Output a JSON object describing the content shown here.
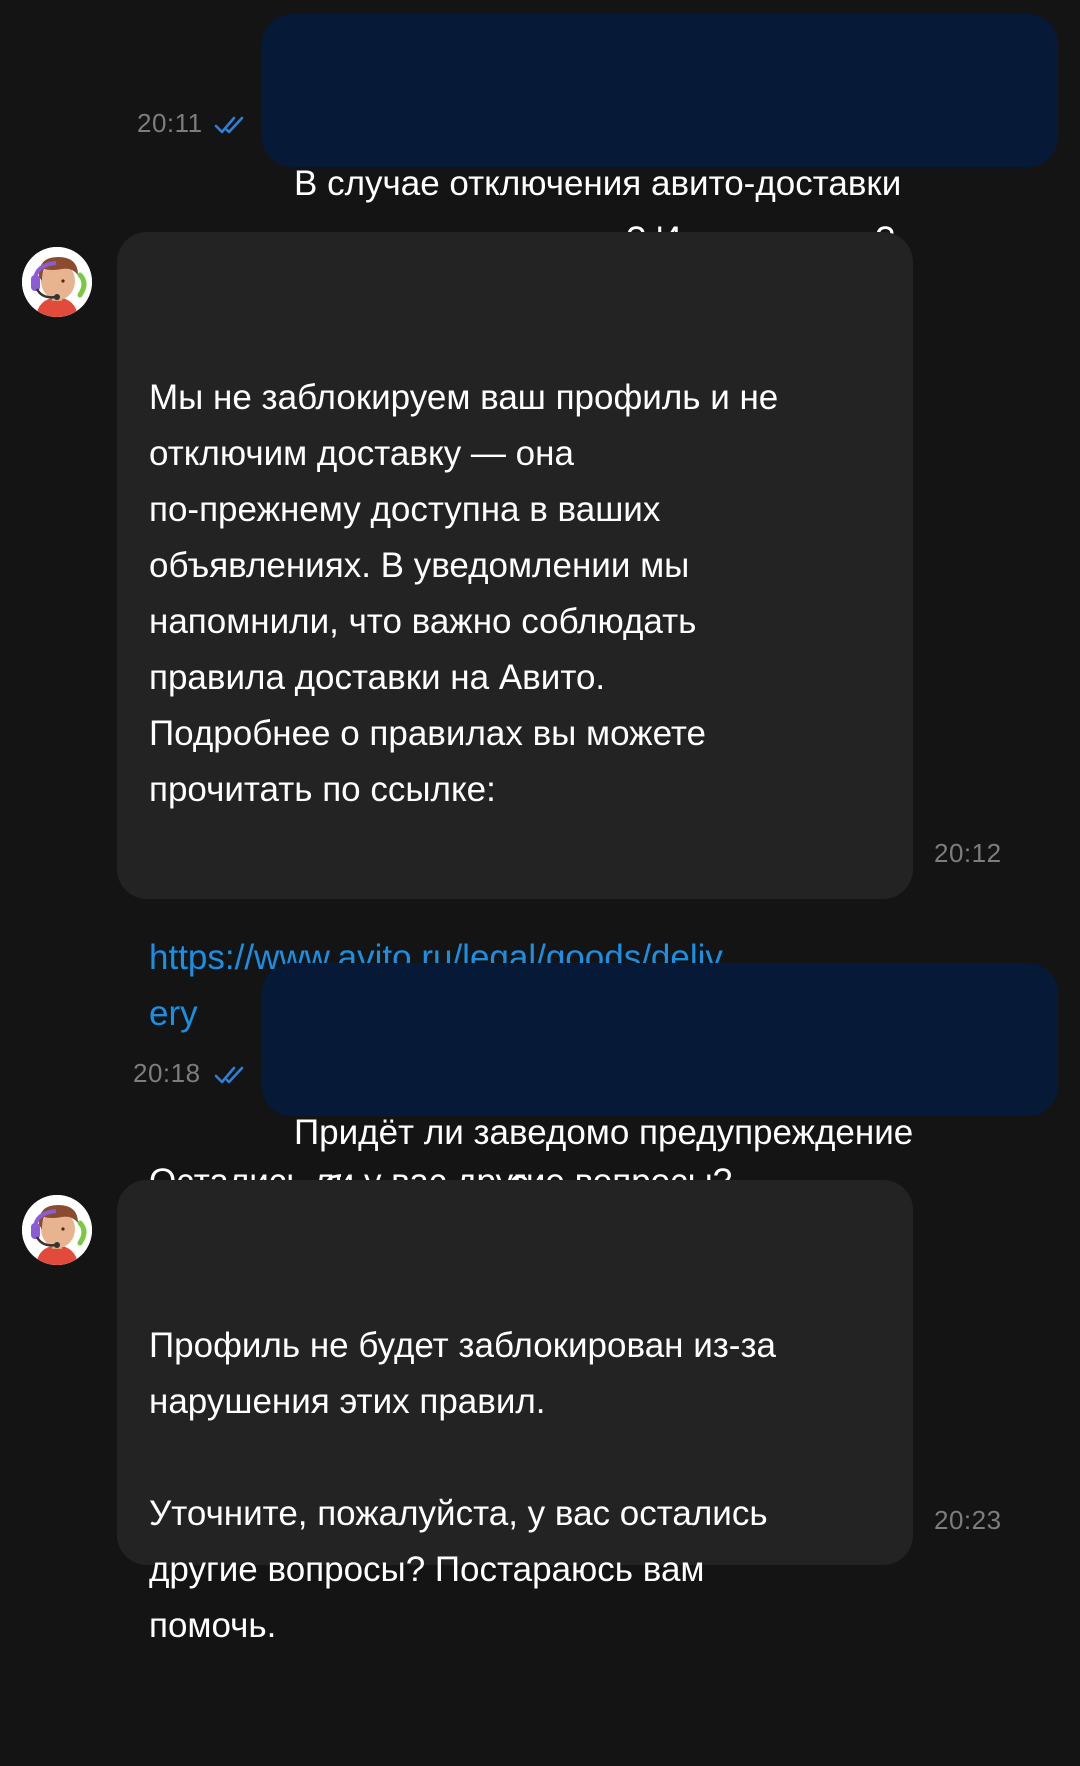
{
  "messages": [
    {
      "direction": "out",
      "text": "В случае отключения авито-доставки\nэто временная мера? Или навсегда?",
      "time": "20:11",
      "status_icon": "double-check-icon"
    },
    {
      "direction": "in",
      "avatar_icon": "support-agent-avatar-icon",
      "text_before_link": "Мы не заблокируем ваш профиль и не\nотключим доставку — она\nпо-прежнему доступна в ваших\nобъявлениях. В уведомлении мы\nнапомнили, что важно соблюдать\nправила доставки на Авито.\nПодробнее о правилах вы можете\nпрочитать по ссылке:",
      "link": "https://www.avito.ru/legal/goods/deliv\nery",
      "text_after_link": "Остались ли у вас другие вопросы?",
      "time": "20:12"
    },
    {
      "direction": "out",
      "text": "Придёт ли заведомо предупреждение\nо блокировке?",
      "time": "20:18",
      "status_icon": "double-check-icon"
    },
    {
      "direction": "in",
      "avatar_icon": "support-agent-avatar-icon",
      "text": "Профиль не будет заблокирован из-за\nнарушения этих правил.\n\nУточните, пожалуйста, у вас остались\nдругие вопросы? Постараюсь вам\nпомочь.",
      "time": "20:23"
    }
  ],
  "colors": {
    "background": "#141414",
    "outgoing_bubble": "#061a37",
    "incoming_bubble": "#232323",
    "link": "#1a8fe6",
    "read_check": "#2f7fd6",
    "timestamp": "#7d7d7d"
  }
}
